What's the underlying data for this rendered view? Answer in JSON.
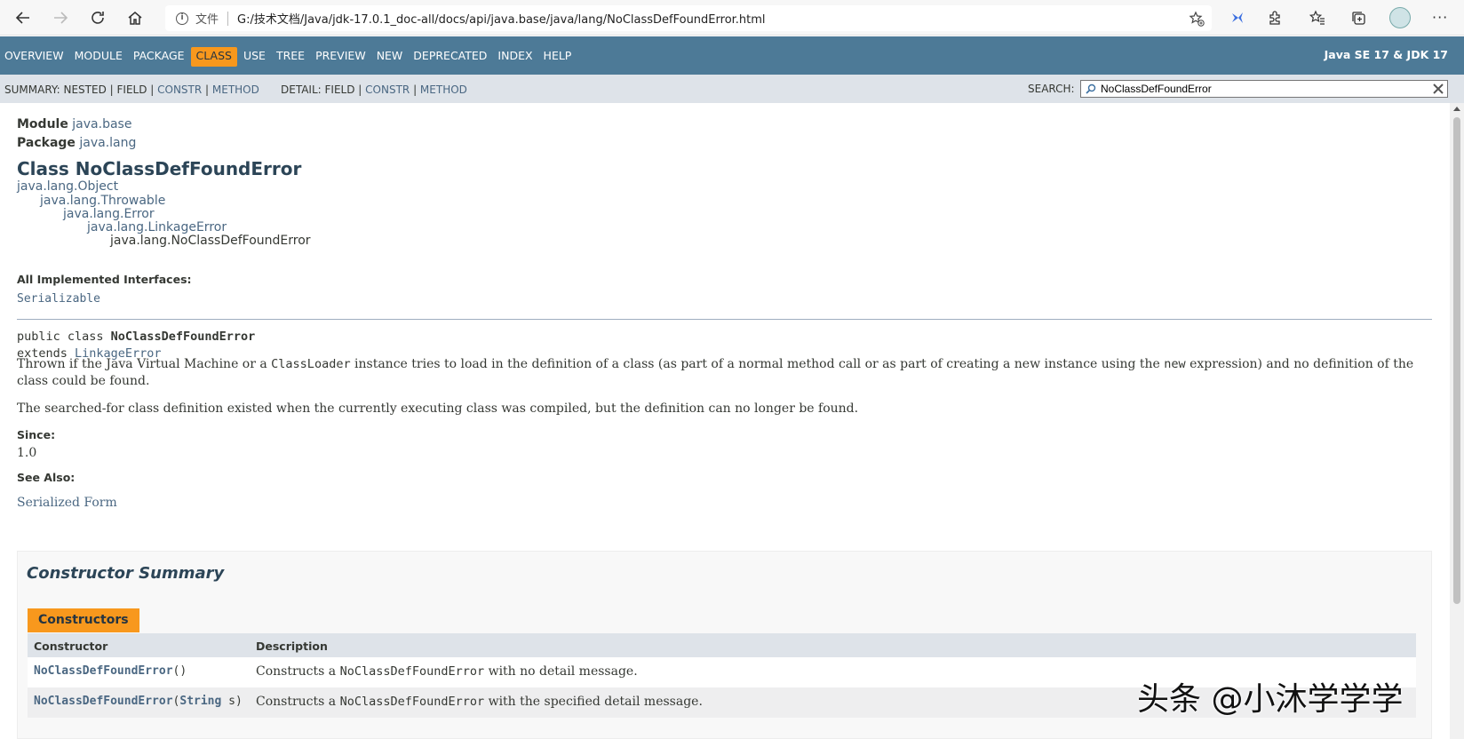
{
  "browser": {
    "file_label": "文件",
    "url": "G:/技术文档/Java/jdk-17.0.1_doc-all/docs/api/java.base/java/lang/NoClassDefFoundError.html"
  },
  "topnav": {
    "items": [
      "OVERVIEW",
      "MODULE",
      "PACKAGE",
      "CLASS",
      "USE",
      "TREE",
      "PREVIEW",
      "NEW",
      "DEPRECATED",
      "INDEX",
      "HELP"
    ],
    "active": "CLASS",
    "brand": "Java SE 17 & JDK 17",
    "accent_color": "#f8981d",
    "bar_color": "#4d7a97"
  },
  "subnav": {
    "summary_label": "SUMMARY:",
    "summary_nested": "NESTED",
    "summary_field": "FIELD",
    "summary_constr": "CONSTR",
    "summary_method": "METHOD",
    "detail_label": "DETAIL:",
    "detail_field": "FIELD",
    "detail_constr": "CONSTR",
    "detail_method": "METHOD",
    "search_label": "SEARCH:",
    "search_value": "NoClassDefFoundError"
  },
  "header": {
    "module_label": "Module",
    "module_value": "java.base",
    "package_label": "Package",
    "package_value": "java.lang",
    "title": "Class NoClassDefFoundError"
  },
  "inheritance": [
    "java.lang.Object",
    "java.lang.Throwable",
    "java.lang.Error",
    "java.lang.LinkageError",
    "java.lang.NoClassDefFoundError"
  ],
  "interfaces": {
    "label": "All Implemented Interfaces:",
    "value": "Serializable"
  },
  "signature": {
    "prefix": "public class ",
    "name": "NoClassDefFoundError",
    "extends_label": "extends ",
    "extends_value": "LinkageError"
  },
  "description": {
    "p1_a": "Thrown if the Java Virtual Machine or a ",
    "p1_code": "ClassLoader",
    "p1_b": " instance tries to load in the definition of a class (as part of a normal method call or as part of creating a new instance using the ",
    "p1_code2": "new",
    "p1_c": " expression) and no definition of the",
    "p1_d": "class could be found.",
    "p2": "The searched-for class definition existed when the currently executing class was compiled, but the definition can no longer be found."
  },
  "since": {
    "label": "Since:",
    "value": "1.0"
  },
  "see_also": {
    "label": "See Also:",
    "value": "Serialized Form"
  },
  "constructor_summary": {
    "title": "Constructor Summary",
    "caption": "Constructors",
    "col1": "Constructor",
    "col2": "Description",
    "rows": [
      {
        "name": "NoClassDefFoundError",
        "args_open": "()",
        "desc_a": "Constructs a ",
        "desc_code": "NoClassDefFoundError",
        "desc_b": " with no detail message."
      },
      {
        "name": "NoClassDefFoundError",
        "args_open": "(",
        "arg_type": "String",
        "args_close": " s)",
        "desc_a": "Constructs a ",
        "desc_code": "NoClassDefFoundError",
        "desc_b": " with the specified detail message."
      }
    ]
  },
  "watermark": "头条 @小沐学学学"
}
